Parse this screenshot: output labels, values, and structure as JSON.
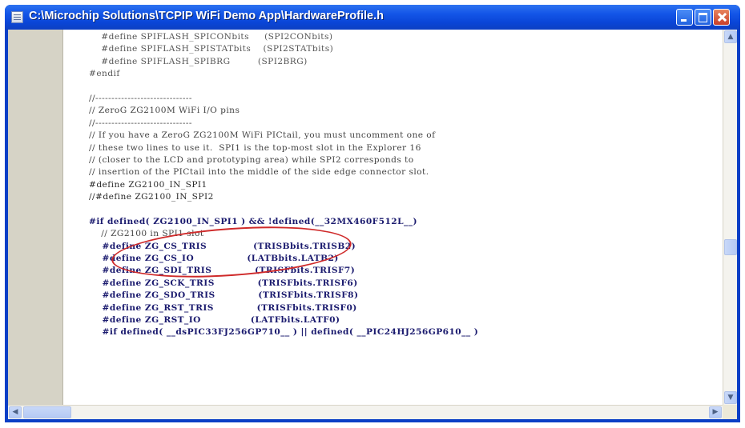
{
  "window": {
    "title": "C:\\Microchip Solutions\\TCPIP WiFi Demo App\\HardwareProfile.h"
  },
  "editor": {
    "lines": [
      {
        "text": "    #define SPIFLASH_SPICONbits     (SPI2CONbits)",
        "style": "plain"
      },
      {
        "text": "    #define SPIFLASH_SPISTATbits    (SPI2STATbits)",
        "style": "plain"
      },
      {
        "text": "    #define SPIFLASH_SPIBRG         (SPI2BRG)",
        "style": "plain"
      },
      {
        "text": "#endif",
        "style": "plain"
      },
      {
        "text": "",
        "style": "plain"
      },
      {
        "text": "//------------------------------",
        "style": "cm"
      },
      {
        "text": "// ZeroG ZG2100M WiFi I/O pins",
        "style": "cm"
      },
      {
        "text": "//------------------------------",
        "style": "cm"
      },
      {
        "text": "// If you have a ZeroG ZG2100M WiFi PICtail, you must uncomment one of",
        "style": "cm"
      },
      {
        "text": "// these two lines to use it.  SPI1 is the top-most slot in the Explorer 16",
        "style": "cm"
      },
      {
        "text": "// (closer to the LCD and prototyping area) while SPI2 corresponds to",
        "style": "cm"
      },
      {
        "text": "// insertion of the PICtail into the middle of the side edge connector slot.",
        "style": "cm"
      },
      {
        "text": "#define ZG2100_IN_SPI1",
        "style": "hl"
      },
      {
        "text": "//#define ZG2100_IN_SPI2",
        "style": "hl"
      },
      {
        "text": "",
        "style": "plain"
      },
      {
        "text": "#if defined( ZG2100_IN_SPI1 ) && !defined(__32MX460F512L__)",
        "style": "kw"
      },
      {
        "text": "    // ZG2100 in SPI1 slot",
        "style": "cm"
      },
      {
        "text": "    #define ZG_CS_TRIS              (TRISBbits.TRISB2)",
        "style": "kw"
      },
      {
        "text": "    #define ZG_CS_IO                (LATBbits.LATB2)",
        "style": "kw"
      },
      {
        "text": "    #define ZG_SDI_TRIS             (TRISFbits.TRISF7)",
        "style": "kw"
      },
      {
        "text": "    #define ZG_SCK_TRIS             (TRISFbits.TRISF6)",
        "style": "kw"
      },
      {
        "text": "    #define ZG_SDO_TRIS             (TRISFbits.TRISF8)",
        "style": "kw"
      },
      {
        "text": "    #define ZG_RST_TRIS             (TRISFbits.TRISF0)",
        "style": "kw"
      },
      {
        "text": "    #define ZG_RST_IO               (LATFbits.LATF0)",
        "style": "kw"
      },
      {
        "text": "    #if defined( __dsPIC33FJ256GP710__ ) || defined( __PIC24HJ256GP610__ )",
        "style": "kw"
      }
    ]
  },
  "icons": {
    "app": "document-icon",
    "minimize": "minimize-icon",
    "maximize": "maximize-icon",
    "close": "close-icon"
  },
  "colors": {
    "titlebar": "#0a46d8",
    "annotation_oval": "#cf2a2a",
    "close_button": "#c8402a"
  }
}
